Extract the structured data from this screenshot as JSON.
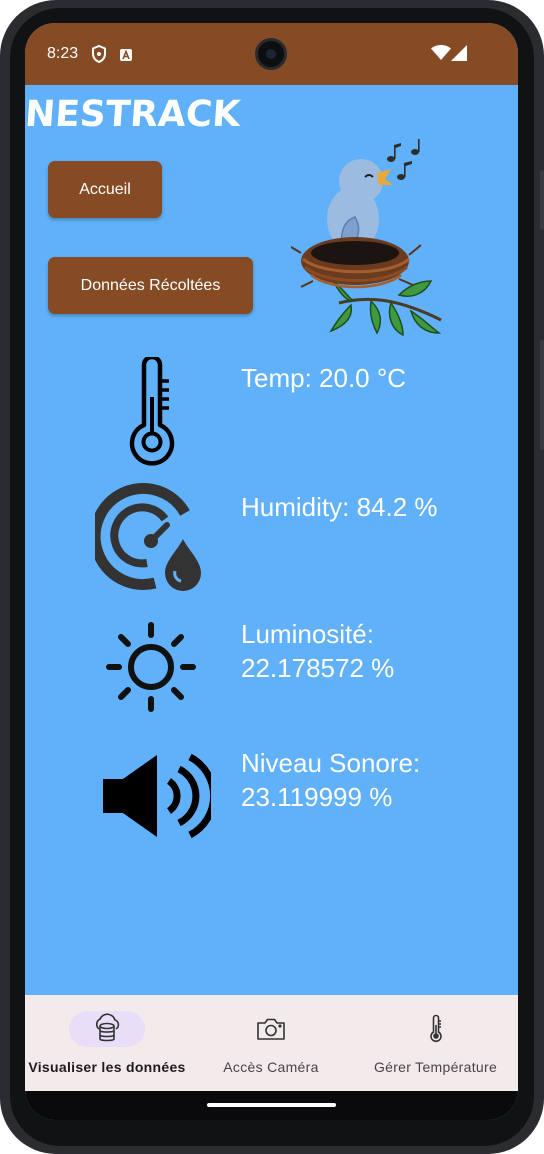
{
  "status_bar": {
    "time": "8:23",
    "background_color": "#844b24",
    "icons": [
      "shield-icon",
      "a-badge-icon",
      "wifi-icon",
      "signal-icon"
    ]
  },
  "app": {
    "title": "NESTRACK",
    "background_color": "#60b1fa",
    "accent_color": "#844b24",
    "illustration": "bird-in-nest"
  },
  "buttons": {
    "home_label": "Accueil",
    "data_label": "Données Récoltées"
  },
  "sensors": [
    {
      "icon": "thermometer-icon",
      "text": "Temp: 20.0 °C"
    },
    {
      "icon": "humidity-gauge-icon",
      "text": "Humidity: 84.2 %"
    },
    {
      "icon": "sun-icon",
      "line1": "Luminosité:",
      "line2": "22.178572 %"
    },
    {
      "icon": "speaker-icon",
      "line1": "Niveau Sonore:",
      "line2": "23.119999 %"
    }
  ],
  "bottom_nav": {
    "active_index": 0,
    "items": [
      {
        "label": "Visualiser les données",
        "icon": "database-cloud-icon"
      },
      {
        "label": "Accès Caméra",
        "icon": "camera-icon"
      },
      {
        "label": "Gérer Température",
        "icon": "thermometer-icon"
      }
    ]
  }
}
